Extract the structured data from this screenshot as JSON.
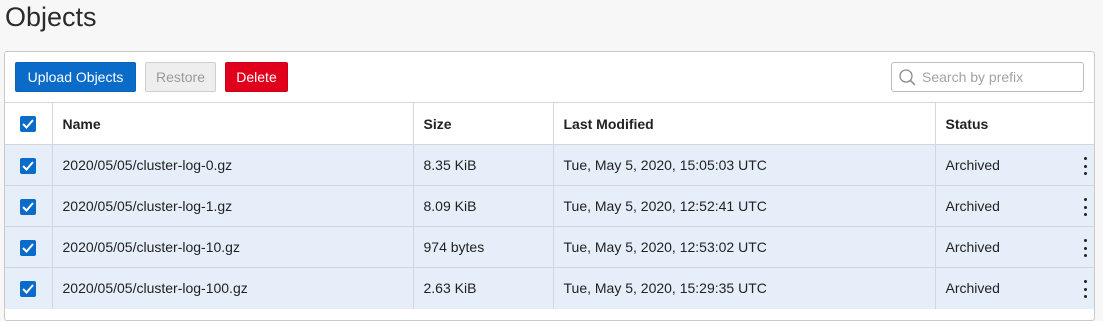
{
  "page": {
    "title": "Objects"
  },
  "toolbar": {
    "upload_label": "Upload Objects",
    "restore_label": "Restore",
    "delete_label": "Delete",
    "search_placeholder": "Search by prefix",
    "search_value": ""
  },
  "table": {
    "select_all_checked": true,
    "headers": {
      "name": "Name",
      "size": "Size",
      "last_modified": "Last Modified",
      "status": "Status"
    },
    "rows": [
      {
        "checked": true,
        "name": "2020/05/05/cluster-log-0.gz",
        "size": "8.35 KiB",
        "last_modified": "Tue, May 5, 2020, 15:05:03 UTC",
        "status": "Archived"
      },
      {
        "checked": true,
        "name": "2020/05/05/cluster-log-1.gz",
        "size": "8.09 KiB",
        "last_modified": "Tue, May 5, 2020, 12:52:41 UTC",
        "status": "Archived"
      },
      {
        "checked": true,
        "name": "2020/05/05/cluster-log-10.gz",
        "size": "974 bytes",
        "last_modified": "Tue, May 5, 2020, 12:53:02 UTC",
        "status": "Archived"
      },
      {
        "checked": true,
        "name": "2020/05/05/cluster-log-100.gz",
        "size": "2.63 KiB",
        "last_modified": "Tue, May 5, 2020, 15:29:35 UTC",
        "status": "Archived"
      }
    ]
  },
  "colors": {
    "primary": "#0a6cc8",
    "danger": "#e0001b",
    "selected_row": "#e6eff9"
  },
  "icons": {
    "search": "search-icon",
    "checkbox": "checkmark-icon",
    "row_actions": "kebab-menu-icon"
  }
}
